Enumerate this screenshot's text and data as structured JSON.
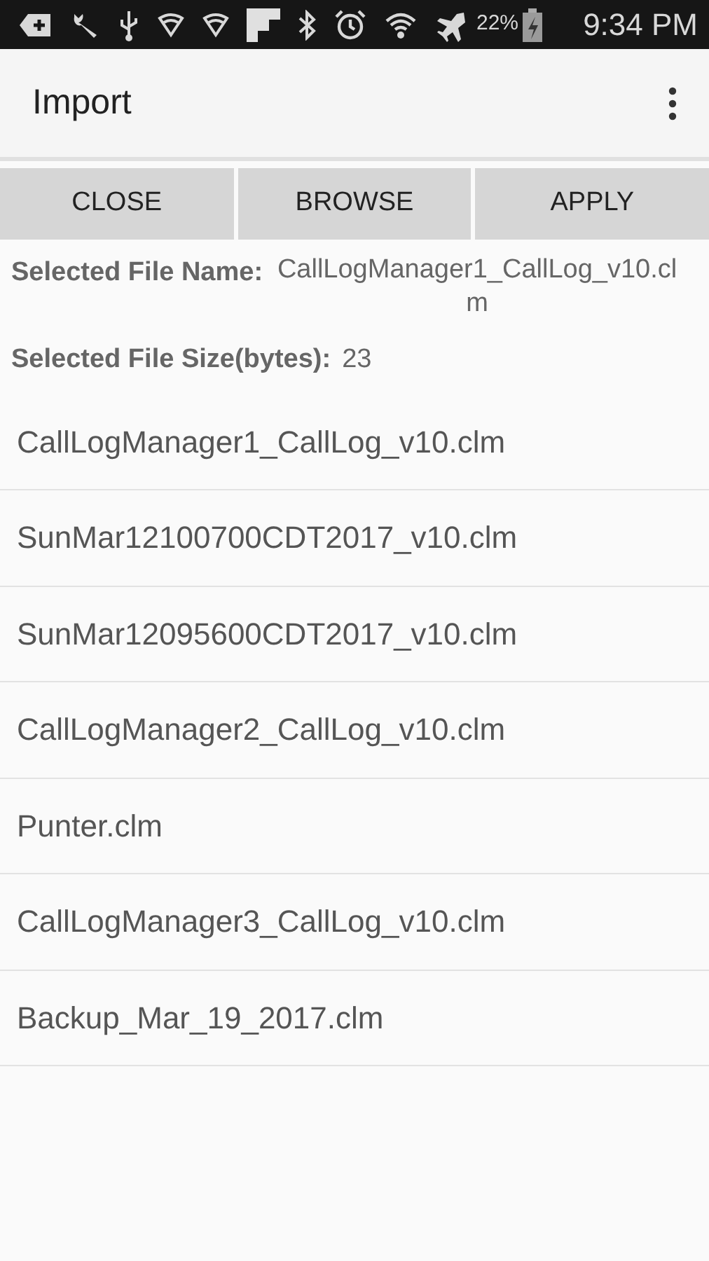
{
  "status_bar": {
    "battery_percent": "22%",
    "time": "9:34 PM"
  },
  "app_bar": {
    "title": "Import"
  },
  "buttons": [
    "CLOSE",
    "BROWSE",
    "APPLY"
  ],
  "selected_file": {
    "name_label": "Selected File Name:",
    "name_value": "CallLogManager1_CallLog_v10.clm",
    "size_label": "Selected File Size(bytes):",
    "size_value": "23"
  },
  "files": [
    "CallLogManager1_CallLog_v10.clm",
    "SunMar12100700CDT2017_v10.clm",
    "SunMar12095600CDT2017_v10.clm",
    "CallLogManager2_CallLog_v10.clm",
    "Punter.clm",
    "CallLogManager3_CallLog_v10.clm",
    "Backup_Mar_19_2017.clm"
  ]
}
